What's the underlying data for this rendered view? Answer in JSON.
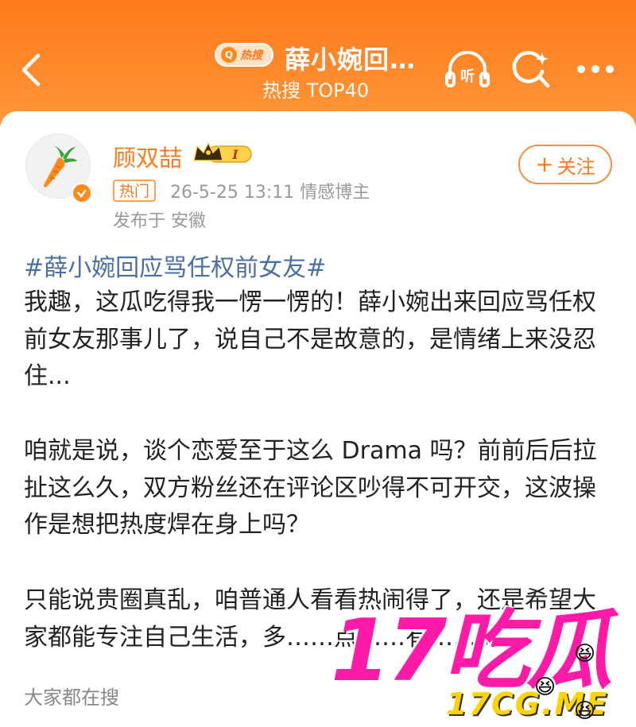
{
  "header": {
    "hot_badge_text": "热搜",
    "hot_badge_icon": "Q",
    "title": "薛小婉回…",
    "subtitle": "热搜 TOP40",
    "listen_label": "听"
  },
  "post": {
    "author": {
      "name": "顾双喆",
      "vip_level": "I",
      "verified": true
    },
    "hot_tag": "热门",
    "meta": "26-5-25 13:11  情感博主",
    "location": "发布于 安徽",
    "follow_label": "关注",
    "hashtag": "#薛小婉回应骂任权前女友#",
    "paragraphs": [
      "我趣，这瓜吃得我一愣一愣的！薛小婉出来回应骂任权前女友那事儿了，说自己不是故意的，是情绪上来没忍住...",
      "咱就是说，谈个恋爱至于这么 Drama 吗？前前后后拉扯这么久，双方粉丝还在评论区吵得不可开交，这波操作是想把热度焊在身上吗？",
      "只能说贵圈真乱，咱普通人看看热闹得了，还是希望大家都能专注自己生活，多……点……有……的"
    ]
  },
  "footer": {
    "section_label": "大家都在搜"
  },
  "watermark": {
    "logo_text": "17吃瓜",
    "url_text": "17CG.ME"
  },
  "colors": {
    "brand_orange": "#ff7a1a",
    "link_blue": "#4a6fa5",
    "watermark_pink": "#ff1aa8",
    "watermark_yellow": "#ffd400"
  }
}
